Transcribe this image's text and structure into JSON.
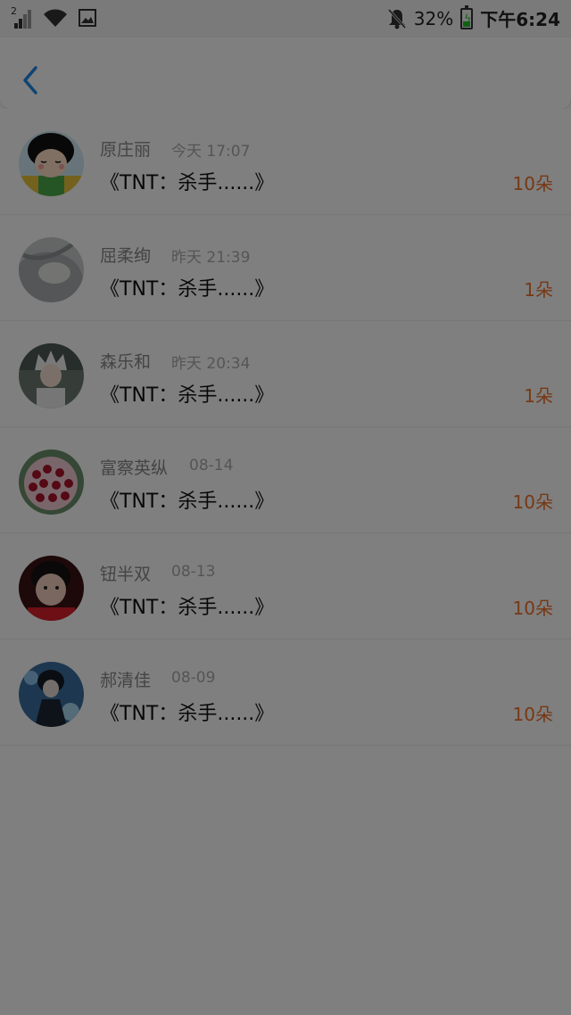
{
  "status_bar": {
    "sim_label": "2",
    "battery_percent": "32%",
    "time": "下午6:24"
  },
  "header": {
    "back_icon": "back-chevron-icon"
  },
  "records": [
    {
      "name": "原庄丽",
      "date": "今天 17:07",
      "gift": "《TNT：杀手......》",
      "amount": "10朵",
      "avatar": "cartoon-girl-avatar"
    },
    {
      "name": "屈柔绚",
      "date": "昨天 21:39",
      "gift": "《TNT：杀手......》",
      "amount": "1朵",
      "avatar": "grey-portrait-avatar"
    },
    {
      "name": "森乐和",
      "date": "昨天 20:34",
      "gift": "《TNT：杀手......》",
      "amount": "1朵",
      "avatar": "white-hair-avatar"
    },
    {
      "name": "富察英纵",
      "date": "08-14",
      "gift": "《TNT：杀手......》",
      "amount": "10朵",
      "avatar": "flower-avatar"
    },
    {
      "name": "钮半双",
      "date": "08-13",
      "gift": "《TNT：杀手......》",
      "amount": "10朵",
      "avatar": "child-avatar"
    },
    {
      "name": "郝清佳",
      "date": "08-09",
      "gift": "《TNT：杀手......》",
      "amount": "10朵",
      "avatar": "anime-avatar"
    }
  ],
  "colors": {
    "accent": "#1e88e5",
    "amount": "#f07028",
    "overlay": "rgba(0,0,0,0.5)"
  }
}
